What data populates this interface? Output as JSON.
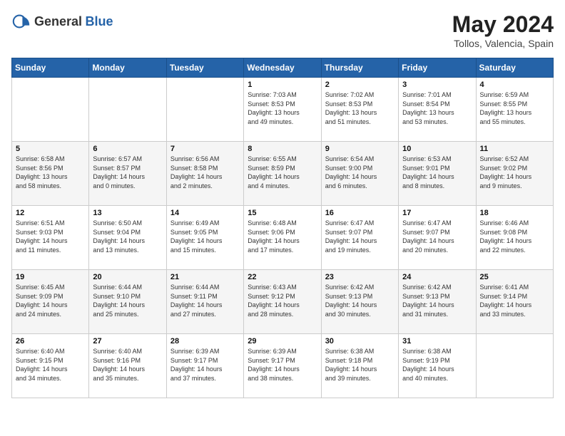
{
  "header": {
    "logo_general": "General",
    "logo_blue": "Blue",
    "month_year": "May 2024",
    "location": "Tollos, Valencia, Spain"
  },
  "days_of_week": [
    "Sunday",
    "Monday",
    "Tuesday",
    "Wednesday",
    "Thursday",
    "Friday",
    "Saturday"
  ],
  "weeks": [
    [
      {
        "day": "",
        "info": ""
      },
      {
        "day": "",
        "info": ""
      },
      {
        "day": "",
        "info": ""
      },
      {
        "day": "1",
        "info": "Sunrise: 7:03 AM\nSunset: 8:53 PM\nDaylight: 13 hours\nand 49 minutes."
      },
      {
        "day": "2",
        "info": "Sunrise: 7:02 AM\nSunset: 8:53 PM\nDaylight: 13 hours\nand 51 minutes."
      },
      {
        "day": "3",
        "info": "Sunrise: 7:01 AM\nSunset: 8:54 PM\nDaylight: 13 hours\nand 53 minutes."
      },
      {
        "day": "4",
        "info": "Sunrise: 6:59 AM\nSunset: 8:55 PM\nDaylight: 13 hours\nand 55 minutes."
      }
    ],
    [
      {
        "day": "5",
        "info": "Sunrise: 6:58 AM\nSunset: 8:56 PM\nDaylight: 13 hours\nand 58 minutes."
      },
      {
        "day": "6",
        "info": "Sunrise: 6:57 AM\nSunset: 8:57 PM\nDaylight: 14 hours\nand 0 minutes."
      },
      {
        "day": "7",
        "info": "Sunrise: 6:56 AM\nSunset: 8:58 PM\nDaylight: 14 hours\nand 2 minutes."
      },
      {
        "day": "8",
        "info": "Sunrise: 6:55 AM\nSunset: 8:59 PM\nDaylight: 14 hours\nand 4 minutes."
      },
      {
        "day": "9",
        "info": "Sunrise: 6:54 AM\nSunset: 9:00 PM\nDaylight: 14 hours\nand 6 minutes."
      },
      {
        "day": "10",
        "info": "Sunrise: 6:53 AM\nSunset: 9:01 PM\nDaylight: 14 hours\nand 8 minutes."
      },
      {
        "day": "11",
        "info": "Sunrise: 6:52 AM\nSunset: 9:02 PM\nDaylight: 14 hours\nand 9 minutes."
      }
    ],
    [
      {
        "day": "12",
        "info": "Sunrise: 6:51 AM\nSunset: 9:03 PM\nDaylight: 14 hours\nand 11 minutes."
      },
      {
        "day": "13",
        "info": "Sunrise: 6:50 AM\nSunset: 9:04 PM\nDaylight: 14 hours\nand 13 minutes."
      },
      {
        "day": "14",
        "info": "Sunrise: 6:49 AM\nSunset: 9:05 PM\nDaylight: 14 hours\nand 15 minutes."
      },
      {
        "day": "15",
        "info": "Sunrise: 6:48 AM\nSunset: 9:06 PM\nDaylight: 14 hours\nand 17 minutes."
      },
      {
        "day": "16",
        "info": "Sunrise: 6:47 AM\nSunset: 9:07 PM\nDaylight: 14 hours\nand 19 minutes."
      },
      {
        "day": "17",
        "info": "Sunrise: 6:47 AM\nSunset: 9:07 PM\nDaylight: 14 hours\nand 20 minutes."
      },
      {
        "day": "18",
        "info": "Sunrise: 6:46 AM\nSunset: 9:08 PM\nDaylight: 14 hours\nand 22 minutes."
      }
    ],
    [
      {
        "day": "19",
        "info": "Sunrise: 6:45 AM\nSunset: 9:09 PM\nDaylight: 14 hours\nand 24 minutes."
      },
      {
        "day": "20",
        "info": "Sunrise: 6:44 AM\nSunset: 9:10 PM\nDaylight: 14 hours\nand 25 minutes."
      },
      {
        "day": "21",
        "info": "Sunrise: 6:44 AM\nSunset: 9:11 PM\nDaylight: 14 hours\nand 27 minutes."
      },
      {
        "day": "22",
        "info": "Sunrise: 6:43 AM\nSunset: 9:12 PM\nDaylight: 14 hours\nand 28 minutes."
      },
      {
        "day": "23",
        "info": "Sunrise: 6:42 AM\nSunset: 9:13 PM\nDaylight: 14 hours\nand 30 minutes."
      },
      {
        "day": "24",
        "info": "Sunrise: 6:42 AM\nSunset: 9:13 PM\nDaylight: 14 hours\nand 31 minutes."
      },
      {
        "day": "25",
        "info": "Sunrise: 6:41 AM\nSunset: 9:14 PM\nDaylight: 14 hours\nand 33 minutes."
      }
    ],
    [
      {
        "day": "26",
        "info": "Sunrise: 6:40 AM\nSunset: 9:15 PM\nDaylight: 14 hours\nand 34 minutes."
      },
      {
        "day": "27",
        "info": "Sunrise: 6:40 AM\nSunset: 9:16 PM\nDaylight: 14 hours\nand 35 minutes."
      },
      {
        "day": "28",
        "info": "Sunrise: 6:39 AM\nSunset: 9:17 PM\nDaylight: 14 hours\nand 37 minutes."
      },
      {
        "day": "29",
        "info": "Sunrise: 6:39 AM\nSunset: 9:17 PM\nDaylight: 14 hours\nand 38 minutes."
      },
      {
        "day": "30",
        "info": "Sunrise: 6:38 AM\nSunset: 9:18 PM\nDaylight: 14 hours\nand 39 minutes."
      },
      {
        "day": "31",
        "info": "Sunrise: 6:38 AM\nSunset: 9:19 PM\nDaylight: 14 hours\nand 40 minutes."
      },
      {
        "day": "",
        "info": ""
      }
    ]
  ]
}
